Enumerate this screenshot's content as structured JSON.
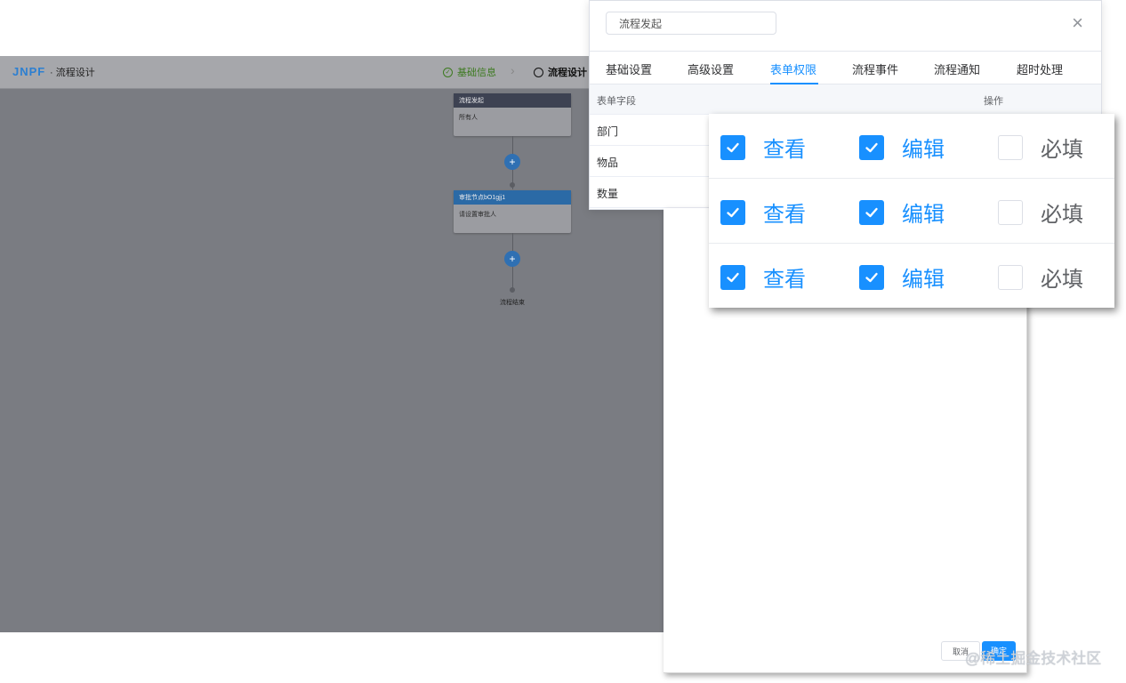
{
  "designer": {
    "logo": "JNPF",
    "title": "· 流程设计",
    "steps": [
      {
        "label": "基础信息",
        "state": "done"
      },
      {
        "label": "流程设计",
        "state": "current"
      }
    ],
    "nodes": [
      {
        "header": "流程发起",
        "body": "所有人"
      },
      {
        "header": "审批节点bO1gjj1",
        "body": "请设置审批人"
      }
    ],
    "end_label": "流程结束"
  },
  "dialog": {
    "title_value": "流程发起",
    "tabs": [
      {
        "label": "基础设置",
        "active": false
      },
      {
        "label": "高级设置",
        "active": false
      },
      {
        "label": "表单权限",
        "active": true
      },
      {
        "label": "流程事件",
        "active": false
      },
      {
        "label": "流程通知",
        "active": false
      },
      {
        "label": "超时处理",
        "active": false
      }
    ],
    "table": {
      "headers": {
        "field": "表单字段",
        "action": "操作"
      },
      "rows": [
        {
          "field": "部门",
          "view": true,
          "edit": true,
          "required": false
        },
        {
          "field": "物品",
          "view": true,
          "edit": true,
          "required": false
        },
        {
          "field": "数量",
          "view": true,
          "edit": true,
          "required": false
        }
      ]
    },
    "permission_labels": {
      "view": "查看",
      "edit": "编辑",
      "required": "必填"
    },
    "buttons": {
      "cancel": "取消",
      "confirm": "确定"
    }
  },
  "watermark": "@稀土掘金技术社区",
  "colors": {
    "primary": "#1890ff",
    "overlay": "#7a7c82"
  }
}
